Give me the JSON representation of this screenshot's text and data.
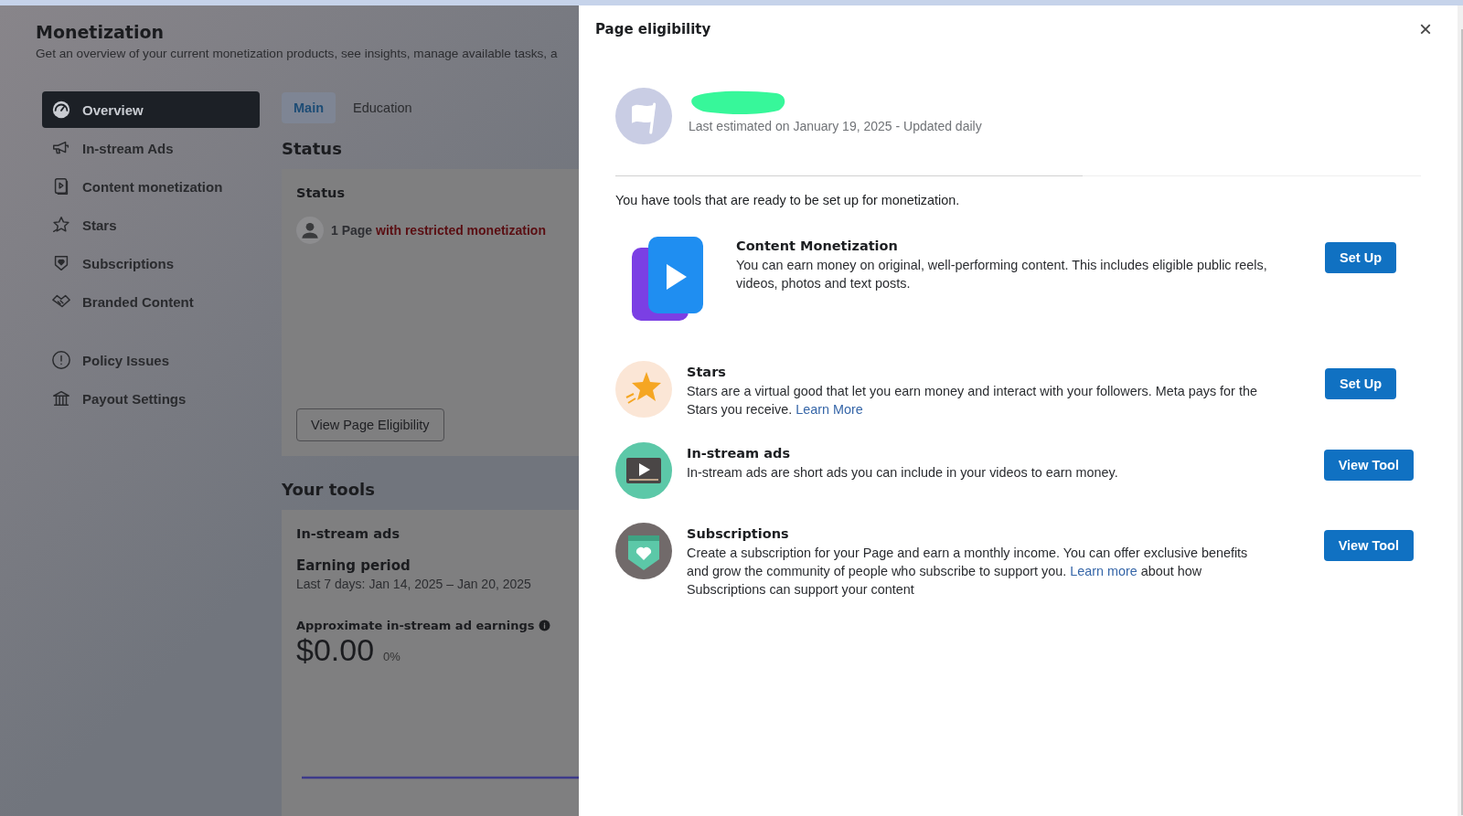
{
  "page": {
    "title": "Monetization",
    "subtitle": "Get an overview of your current monetization products, see insights, manage available tasks, a"
  },
  "sidebar": {
    "groups": [
      {
        "items": [
          {
            "label": "Overview",
            "selected": true
          },
          {
            "label": "In-stream Ads",
            "selected": false
          },
          {
            "label": "Content monetization",
            "selected": false
          },
          {
            "label": "Stars",
            "selected": false
          },
          {
            "label": "Subscriptions",
            "selected": false
          },
          {
            "label": "Branded Content",
            "selected": false
          }
        ]
      },
      {
        "items": [
          {
            "label": "Policy Issues",
            "selected": false
          },
          {
            "label": "Payout Settings",
            "selected": false
          }
        ]
      }
    ]
  },
  "tabs": [
    {
      "label": "Main",
      "selected": true
    },
    {
      "label": "Education",
      "selected": false
    }
  ],
  "status_section": {
    "heading": "Status",
    "card_title": "Status",
    "count": "1 Page",
    "restriction": "with restricted monetization",
    "button": "View Page Eligibility"
  },
  "tools_section": {
    "heading": "Your tools",
    "card_title": "In-stream ads",
    "period_label": "Earning period",
    "period": "Last 7 days: Jan 14, 2025 – Jan 20, 2025",
    "earnings_label": "Approximate in-stream ad earnings",
    "amount": "$0.00",
    "change": "0%"
  },
  "dialog": {
    "title": "Page eligibility",
    "close": "×",
    "estimate": "Last estimated on January 19, 2025 - Updated daily",
    "intro": "You have tools that are ready to be set up for monetization.",
    "tools": [
      {
        "kind": "content",
        "title": "Content Monetization",
        "description": [
          {
            "text": "You can earn money on original, well-performing content. This includes eligible public reels, videos, photos and text posts."
          }
        ],
        "button": "Set Up"
      },
      {
        "kind": "stars",
        "title": "Stars",
        "description": [
          {
            "text": "Stars are a virtual good that let you earn money and interact with your followers. Meta pays for the Stars you receive. "
          },
          {
            "link": "Learn More"
          }
        ],
        "button": "Set Up"
      },
      {
        "kind": "ads",
        "title": "In-stream ads",
        "description": [
          {
            "text": "In-stream ads are short ads you can include in your videos to earn money."
          }
        ],
        "button": "View Tool"
      },
      {
        "kind": "subscriptions",
        "title": "Subscriptions",
        "description": [
          {
            "text": "Create a subscription for your Page and earn a monthly income. You can offer exclusive benefits and grow the community of people who subscribe to support you. "
          },
          {
            "link": "Learn more"
          },
          {
            "text": " about how Subscriptions can support your content"
          }
        ],
        "button": "View Tool"
      }
    ]
  }
}
